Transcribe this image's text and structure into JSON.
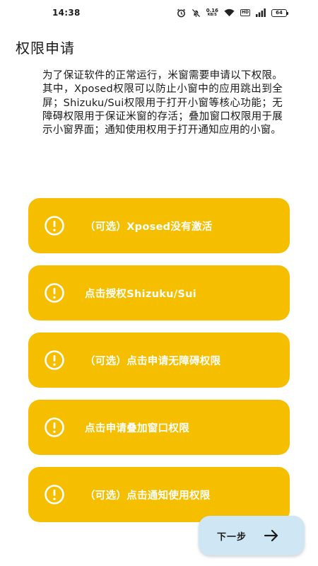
{
  "status_bar": {
    "time": "14:38",
    "net_speed_value": "0.16",
    "net_speed_unit": "KB/S",
    "hd_label": "HD",
    "battery_level": "64"
  },
  "page": {
    "title": "权限申请",
    "description": "为了保证软件的正常运行，米窗需要申请以下权限。其中，Xposed权限可以防止小窗中的应用跳出到全屏；Shizuku/Sui权限用于打开小窗等核心功能；无障碍权限用于保证米窗的存活；叠加窗口权限用于展示小窗界面；通知使用权用于打开通知应用的小窗。"
  },
  "permissions": [
    {
      "label": "（可选）Xposed没有激活",
      "icon": "alert-circle-icon"
    },
    {
      "label": "点击授权Shizuku/Sui",
      "icon": "alert-circle-icon"
    },
    {
      "label": "（可选）点击申请无障碍权限",
      "icon": "alert-circle-icon"
    },
    {
      "label": "点击申请叠加窗口权限",
      "icon": "alert-circle-icon"
    },
    {
      "label": "（可选）点击通知使用权限",
      "icon": "alert-circle-icon"
    }
  ],
  "next_button": {
    "label": "下一步",
    "icon": "arrow-right-icon"
  },
  "colors": {
    "card": "#f5bf00",
    "card_text": "#ffffff",
    "next_button_bg": "#cfe6f5",
    "background": "#ffffff"
  }
}
